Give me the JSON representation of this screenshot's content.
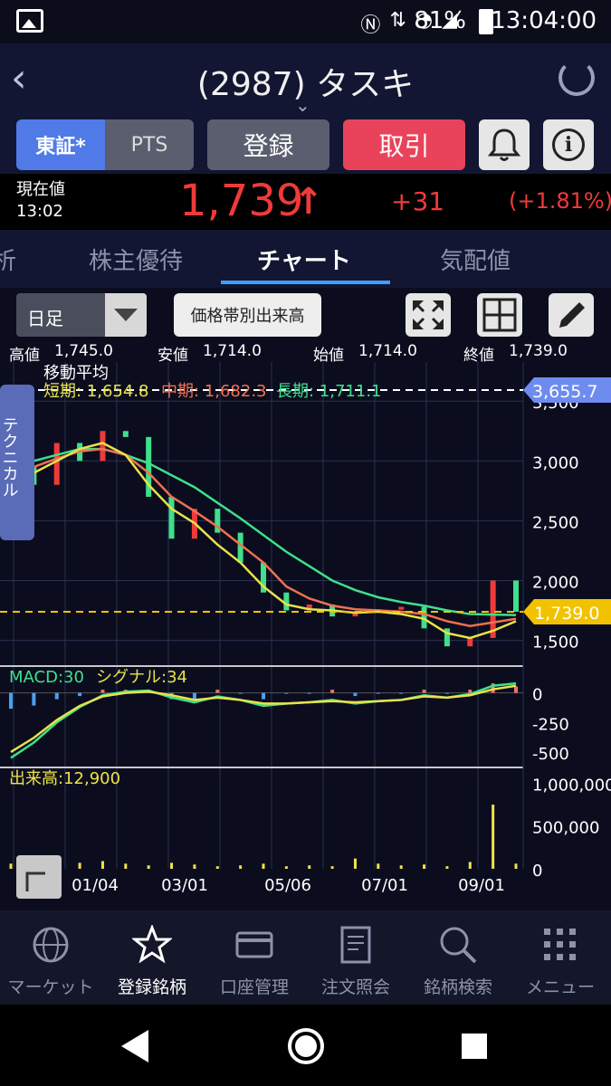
{
  "status": {
    "battery": "81%",
    "time": "13:04:00"
  },
  "header": {
    "title": "(2987) タスキ"
  },
  "actions": {
    "market_primary": "東証*",
    "market_pts": "PTS",
    "register": "登録",
    "trade": "取引"
  },
  "quote": {
    "label": "現在値",
    "time": "13:02",
    "price": "1,739",
    "arrow": "↑",
    "change": "+31",
    "change_pct": "(+1.81%)"
  },
  "tabs": [
    "析",
    "株主優待",
    "チャート",
    "気配値"
  ],
  "toolbar": {
    "period": "日足",
    "volume_profile": "価格帯別出来高"
  },
  "ohlc": {
    "high_label": "高値",
    "high": "1,745.0",
    "low_label": "安値",
    "low": "1,714.0",
    "open_label": "始値",
    "open": "1,714.0",
    "close_label": "終値",
    "close": "1,739.0"
  },
  "chart_labels": {
    "ma_title": "移動平均",
    "ma_short": "短期: 1,654.8",
    "ma_mid": "中期: 1,682.3",
    "ma_long": "長期: 1,711.1",
    "side_tab": "テクニカル",
    "high_marker": "3,655.7",
    "current_marker": "1,739.0",
    "macd": "MACD:30",
    "signal": "シグナル:34",
    "volume": "出来高:12,900"
  },
  "colors": {
    "up": "#f03a3a",
    "ma_short": "#e8e24a",
    "ma_mid": "#f07050",
    "ma_long": "#3ee08a",
    "accent": "#4f7ae8"
  },
  "chart_data": [
    {
      "type": "line",
      "title": "",
      "x_ticks": [
        "01/04",
        "03/01",
        "05/06",
        "07/01",
        "09/01"
      ],
      "y_ticks": [
        "3,500",
        "3,000",
        "2,500",
        "2,000",
        "1,500"
      ],
      "ylim": [
        1300,
        3600
      ],
      "series": [
        {
          "name": "短期",
          "color": "#e8e24a",
          "values": [
            2850,
            2900,
            3000,
            3100,
            3150,
            3050,
            2800,
            2600,
            2480,
            2300,
            2150,
            1950,
            1800,
            1760,
            1750,
            1730,
            1740,
            1720,
            1680,
            1560,
            1520,
            1580,
            1660
          ]
        },
        {
          "name": "中期",
          "color": "#f07050",
          "values": [
            2880,
            2950,
            3020,
            3080,
            3100,
            3050,
            2900,
            2700,
            2580,
            2450,
            2300,
            2150,
            1950,
            1850,
            1790,
            1760,
            1750,
            1740,
            1720,
            1660,
            1620,
            1650,
            1680
          ]
        },
        {
          "name": "長期",
          "color": "#3ee08a",
          "values": [
            2950,
            3000,
            3050,
            3100,
            3100,
            3050,
            2980,
            2880,
            2780,
            2650,
            2520,
            2380,
            2240,
            2120,
            2000,
            1920,
            1860,
            1820,
            1790,
            1750,
            1720,
            1715,
            1711
          ]
        },
        {
          "name": "終値",
          "color": "#f03a3a",
          "values": [
            2950,
            2800,
            3150,
            3000,
            3250,
            3200,
            2700,
            2350,
            2600,
            2400,
            2150,
            1900,
            1750,
            1800,
            1700,
            1740,
            1760,
            1780,
            1600,
            1450,
            1520,
            2000,
            1739
          ]
        }
      ]
    },
    {
      "type": "line",
      "title": "MACD",
      "y_ticks": [
        "0",
        "-250",
        "-500"
      ],
      "ylim": [
        -600,
        150
      ],
      "series": [
        {
          "name": "MACD",
          "color": "#3ee08a",
          "values": [
            -550,
            -420,
            -250,
            -120,
            -20,
            10,
            20,
            -40,
            -80,
            -30,
            -60,
            -110,
            -90,
            -80,
            -60,
            -90,
            -70,
            -60,
            -20,
            -40,
            -10,
            60,
            80
          ]
        },
        {
          "name": "シグナル",
          "color": "#e8e24a",
          "values": [
            -500,
            -380,
            -230,
            -110,
            -30,
            0,
            10,
            -20,
            -60,
            -40,
            -60,
            -90,
            -90,
            -80,
            -70,
            -80,
            -70,
            -60,
            -30,
            -40,
            -20,
            30,
            60
          ]
        }
      ]
    },
    {
      "type": "bar",
      "title": "出来高",
      "y_ticks": [
        "1,000,000",
        "500,000",
        "0"
      ],
      "ylim": [
        0,
        1100000
      ],
      "values": [
        60000,
        80000,
        50000,
        70000,
        90000,
        60000,
        40000,
        70000,
        50000,
        30000,
        40000,
        60000,
        30000,
        40000,
        30000,
        120000,
        60000,
        40000,
        50000,
        30000,
        80000,
        750000,
        60000
      ]
    }
  ],
  "nav": [
    "マーケット",
    "登録銘柄",
    "口座管理",
    "注文照会",
    "銘柄検索",
    "メニュー"
  ]
}
